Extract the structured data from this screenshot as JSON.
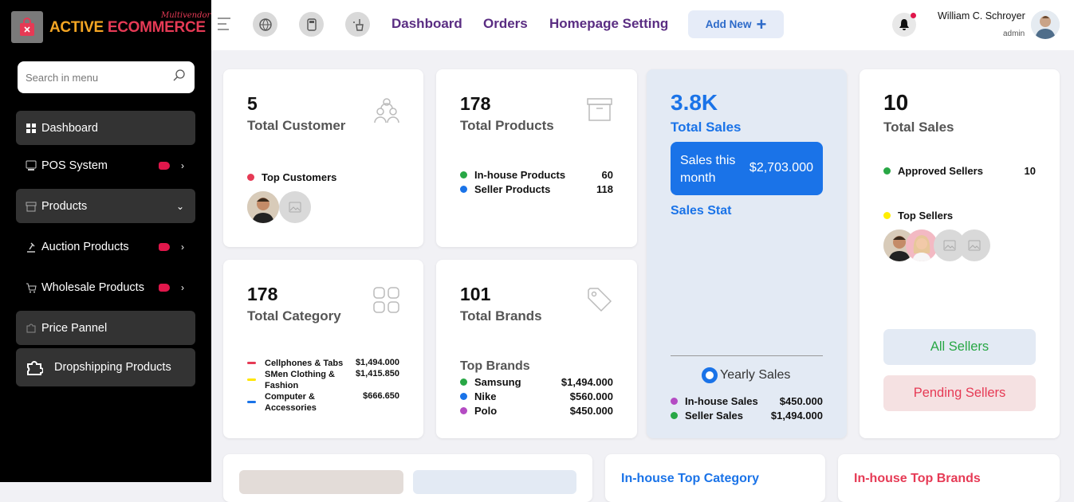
{
  "brand": {
    "name_part1": "ACTIVE ",
    "name_part2": "ECOMMERCE",
    "tagline": "Multivendor",
    "primary": "#f5a623",
    "accent": "#e63a55"
  },
  "sidebar": {
    "search_placeholder": "Search in menu",
    "items": [
      {
        "label": "Dashboard",
        "icon": "grid-icon"
      },
      {
        "label": "POS System",
        "icon": "pos-icon",
        "badge": true
      },
      {
        "label": "Products",
        "icon": "box-icon"
      },
      {
        "label": "Auction Products",
        "icon": "gavel-icon",
        "badge": true
      },
      {
        "label": "Wholesale Products",
        "icon": "cart-icon",
        "badge": true
      },
      {
        "label": "Price Pannel",
        "icon": "puzzle-icon"
      },
      {
        "label": "Dropshipping Products",
        "icon": "puzzle-icon"
      }
    ]
  },
  "topbar": {
    "nav": [
      "Dashboard",
      "Orders",
      "Homepage Setting"
    ],
    "add_new": "Add New",
    "user_name": "William C. Schroyer",
    "user_role": "admin"
  },
  "cards": {
    "customers": {
      "value": "5",
      "label": "Total Customer",
      "sub": "Top Customers"
    },
    "products": {
      "value": "178",
      "label": "Total Products",
      "rows": [
        {
          "label": "In-house Products",
          "value": "60",
          "color": "#28a745"
        },
        {
          "label": "Seller Products",
          "value": "118",
          "color": "#1a73e8"
        }
      ]
    },
    "sales": {
      "value": "3.8K",
      "label": "Total Sales",
      "month_label": "Sales this month",
      "month_value": "$2,703.000",
      "stat": "Sales Stat",
      "yearly": "Yearly Sales",
      "rows": [
        {
          "label": "In-house Sales",
          "value": "$450.000",
          "color": "#b44bc3"
        },
        {
          "label": "Seller Sales",
          "value": "$1,494.000",
          "color": "#28a745"
        }
      ]
    },
    "sellers": {
      "value": "10",
      "label": "Total Sales",
      "approved_label": "Approved Sellers",
      "approved_value": "10",
      "top_label": "Top Sellers",
      "all_btn": "All Sellers",
      "pending_btn": "Pending Sellers"
    },
    "category": {
      "value": "178",
      "label": "Total Category",
      "rows": [
        {
          "label": "Cellphones & Tabs",
          "value": "$1,494.000",
          "color": "#e63a55"
        },
        {
          "label": "SMen Clothing & Fashion",
          "value": "$1,415.850",
          "color": "#ffe600"
        },
        {
          "label": "Computer & Accessories",
          "value": "$666.650",
          "color": "#1a73e8"
        }
      ]
    },
    "brands": {
      "value": "101",
      "label": "Total Brands",
      "top_label": "Top Brands",
      "rows": [
        {
          "label": "Samsung",
          "value": "$1,494.000",
          "color": "#28a745"
        },
        {
          "label": "Nike",
          "value": "$560.000",
          "color": "#1a73e8"
        },
        {
          "label": "Polo",
          "value": "$450.000",
          "color": "#b44bc3"
        }
      ]
    }
  },
  "bottom": {
    "inhouse_category": "In-house Top Category",
    "inhouse_brands": "In-house Top Brands"
  }
}
